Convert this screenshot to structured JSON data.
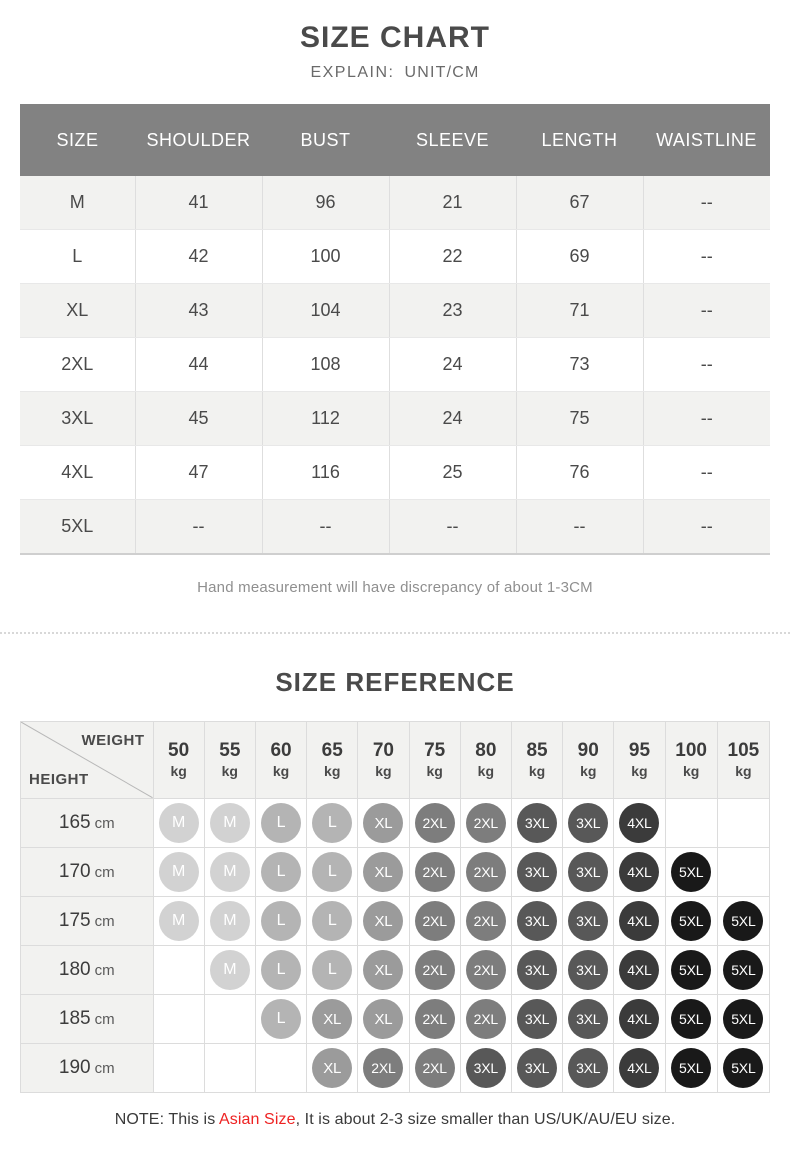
{
  "size_chart": {
    "title": "SIZE CHART",
    "subtitle_label": "EXPLAIN:",
    "subtitle_value": "UNIT/CM",
    "columns": [
      "SIZE",
      "SHOULDER",
      "BUST",
      "SLEEVE",
      "LENGTH",
      "WAISTLINE"
    ],
    "rows": [
      {
        "size": "M",
        "shoulder": "41",
        "bust": "96",
        "sleeve": "21",
        "length": "67",
        "waistline": "--"
      },
      {
        "size": "L",
        "shoulder": "42",
        "bust": "100",
        "sleeve": "22",
        "length": "69",
        "waistline": "--"
      },
      {
        "size": "XL",
        "shoulder": "43",
        "bust": "104",
        "sleeve": "23",
        "length": "71",
        "waistline": "--"
      },
      {
        "size": "2XL",
        "shoulder": "44",
        "bust": "108",
        "sleeve": "24",
        "length": "73",
        "waistline": "--"
      },
      {
        "size": "3XL",
        "shoulder": "45",
        "bust": "112",
        "sleeve": "24",
        "length": "75",
        "waistline": "--"
      },
      {
        "size": "4XL",
        "shoulder": "47",
        "bust": "116",
        "sleeve": "25",
        "length": "76",
        "waistline": "--"
      },
      {
        "size": "5XL",
        "shoulder": "--",
        "bust": "--",
        "sleeve": "--",
        "length": "--",
        "waistline": "--"
      }
    ],
    "hand_note": "Hand measurement will have discrepancy of about 1-3CM"
  },
  "size_reference": {
    "title": "SIZE REFERENCE",
    "weight_label": "WEIGHT",
    "height_label": "HEIGHT",
    "weight_unit": "kg",
    "height_unit": "cm",
    "weights": [
      "50",
      "55",
      "60",
      "65",
      "70",
      "75",
      "80",
      "85",
      "90",
      "95",
      "100",
      "105"
    ],
    "heights": [
      "165",
      "170",
      "175",
      "180",
      "185",
      "190"
    ],
    "grid": [
      [
        "M",
        "M",
        "L",
        "L",
        "XL",
        "2XL",
        "2XL",
        "3XL",
        "3XL",
        "4XL",
        "",
        ""
      ],
      [
        "M",
        "M",
        "L",
        "L",
        "XL",
        "2XL",
        "2XL",
        "3XL",
        "3XL",
        "4XL",
        "5XL",
        ""
      ],
      [
        "M",
        "M",
        "L",
        "L",
        "XL",
        "2XL",
        "2XL",
        "3XL",
        "3XL",
        "4XL",
        "5XL",
        "5XL"
      ],
      [
        "",
        "M",
        "L",
        "L",
        "XL",
        "2XL",
        "2XL",
        "3XL",
        "3XL",
        "4XL",
        "5XL",
        "5XL"
      ],
      [
        "",
        "",
        "L",
        "XL",
        "XL",
        "2XL",
        "2XL",
        "3XL",
        "3XL",
        "4XL",
        "5XL",
        "5XL"
      ],
      [
        "",
        "",
        "",
        "XL",
        "2XL",
        "2XL",
        "3XL",
        "3XL",
        "3XL",
        "4XL",
        "5XL",
        "5XL"
      ]
    ]
  },
  "footer": {
    "note_prefix": "NOTE: This is ",
    "note_accent": "Asian Size",
    "note_suffix": ", It is about 2-3 size smaller than US/UK/AU/EU size."
  },
  "colors": {
    "header_gray": "#828282",
    "row_alt": "#f2f2f0",
    "accent_red": "#ee2222",
    "badge_M": "#d2d2d2",
    "badge_L": "#b4b4b4",
    "badge_XL": "#9b9b9b",
    "badge_2XL": "#7d7d7d",
    "badge_3XL": "#585858",
    "badge_4XL": "#3b3b3b",
    "badge_5XL": "#191919"
  }
}
